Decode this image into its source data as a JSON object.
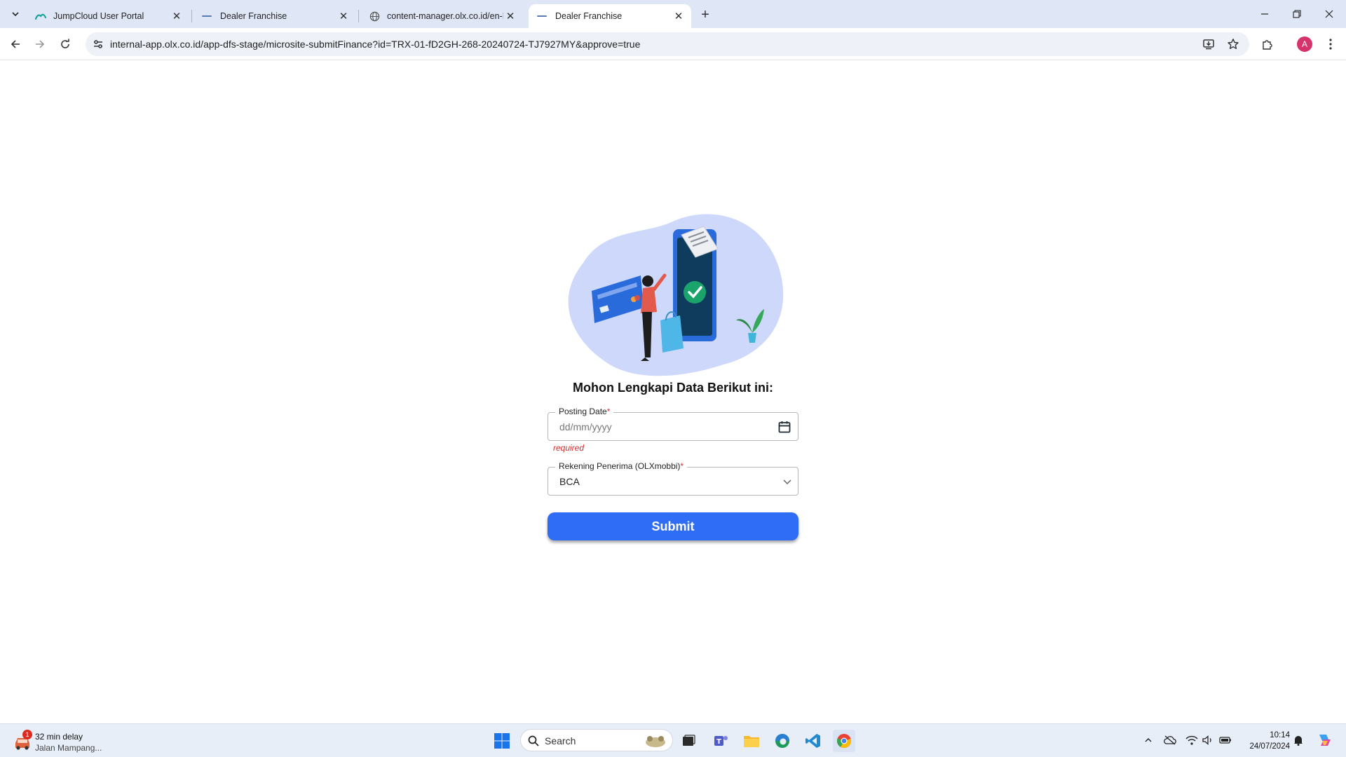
{
  "browser": {
    "tabs": [
      {
        "title": "JumpCloud User Portal",
        "favicon": "jumpcloud-icon",
        "active": false
      },
      {
        "title": "Dealer Franchise",
        "favicon": "dash-icon",
        "active": false
      },
      {
        "title": "content-manager.olx.co.id/en-I",
        "favicon": "globe-icon",
        "active": false
      },
      {
        "title": "Dealer Franchise",
        "favicon": "dash-icon",
        "active": true
      }
    ],
    "url": "internal-app.olx.co.id/app-dfs-stage/microsite-submitFinance?id=TRX-01-fD2GH-268-20240724-TJ7927MY&approve=true",
    "profile_initial": "A",
    "profile_color": "#d6336c"
  },
  "form": {
    "heading": "Mohon Lengkapi Data Berikut ini:",
    "posting_date": {
      "label": "Posting Date",
      "required_mark": "*",
      "placeholder": "dd/mm/yyyy",
      "error": "required"
    },
    "rekening": {
      "label": "Rekening Penerima (OLXmobbi)",
      "required_mark": "*",
      "value": "BCA"
    },
    "submit_label": "Submit",
    "accent_color": "#2f6df6",
    "error_color": "#d32f2f"
  },
  "taskbar": {
    "weather_badge": "1",
    "weather_line1": "32 min delay",
    "weather_line2": "Jalan Mampang...",
    "search_label": "Search",
    "time": "10:14",
    "date": "24/07/2024"
  }
}
